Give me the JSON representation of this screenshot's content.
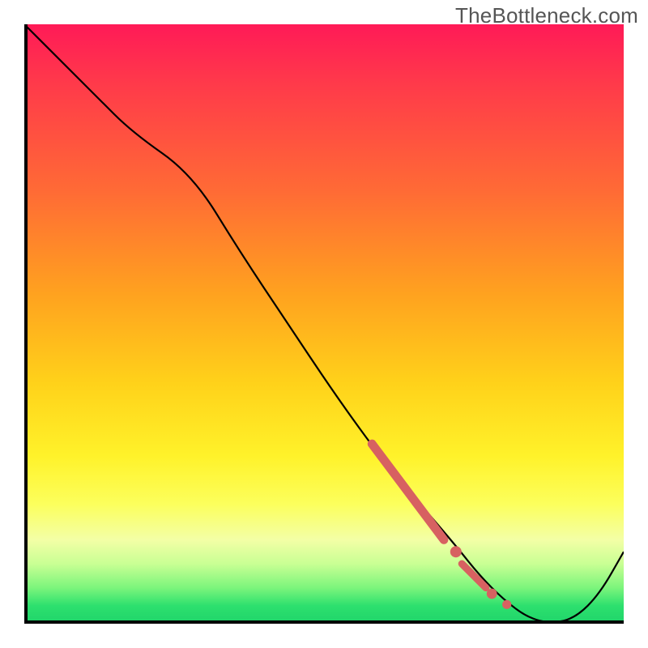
{
  "watermark": "TheBottleneck.com",
  "colors": {
    "curve": "#000000",
    "markers": "#d76161",
    "markers_stroke": "#a63d3d"
  },
  "chart_data": {
    "type": "line",
    "title": "",
    "xlabel": "",
    "ylabel": "",
    "xlim": [
      0,
      100
    ],
    "ylim": [
      0,
      100
    ],
    "grid": false,
    "legend": false,
    "notes": "Gradient background red→yellow→green top-to-bottom. Black curve with salmon-colored marker segments near the valley. Axes drawn only on left and bottom edges (black). No ticks, no labels.",
    "series": [
      {
        "name": "curve",
        "x": [
          0,
          6,
          12,
          18,
          28,
          36,
          44,
          52,
          60,
          66,
          72,
          76,
          80,
          84,
          88,
          92,
          96,
          100
        ],
        "y": [
          100,
          94,
          88,
          82,
          75,
          62,
          50,
          38,
          27,
          20,
          13,
          8,
          4,
          1,
          0,
          1,
          5,
          12
        ]
      }
    ],
    "markers": [
      {
        "shape": "thick-segment",
        "x1": 58,
        "y1": 30,
        "x2": 70,
        "y2": 14,
        "width": 6
      },
      {
        "shape": "dot",
        "cx": 72,
        "cy": 12,
        "r": 3.5
      },
      {
        "shape": "thick-segment",
        "x1": 73,
        "y1": 10,
        "x2": 77,
        "y2": 6,
        "width": 5
      },
      {
        "shape": "dot",
        "cx": 78,
        "cy": 5,
        "r": 3.2
      },
      {
        "shape": "dot",
        "cx": 80.5,
        "cy": 3.2,
        "r": 2.8
      }
    ]
  }
}
